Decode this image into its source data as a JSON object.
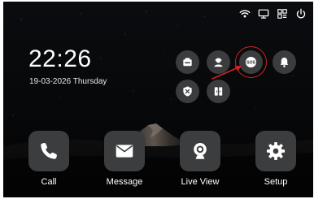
{
  "status_bar": {
    "icons": [
      "wifi-icon",
      "monitor-icon",
      "grid-icon",
      "power-icon"
    ]
  },
  "clock": {
    "time": "22:26",
    "date": "19-03-2026 Thursday"
  },
  "quick_actions": [
    {
      "name": "alarm-panel",
      "icon": "alarm-panel-icon"
    },
    {
      "name": "contact",
      "icon": "contact-icon"
    },
    {
      "name": "sos",
      "icon": "sos-icon",
      "label": "SOS"
    },
    {
      "name": "bell",
      "icon": "bell-icon"
    },
    {
      "name": "disarm",
      "icon": "disarm-icon"
    },
    {
      "name": "door",
      "icon": "door-icon"
    }
  ],
  "apps": [
    {
      "label": "Call",
      "icon": "phone-icon"
    },
    {
      "label": "Message",
      "icon": "mail-icon"
    },
    {
      "label": "Live View",
      "icon": "camera-icon"
    },
    {
      "label": "Setup",
      "icon": "gear-icon"
    }
  ],
  "colors": {
    "background": "#050607",
    "tile": "#3c3d3f",
    "quick_button": "#3a3c3e",
    "highlight": "#d62027",
    "text": "#ffffff"
  }
}
